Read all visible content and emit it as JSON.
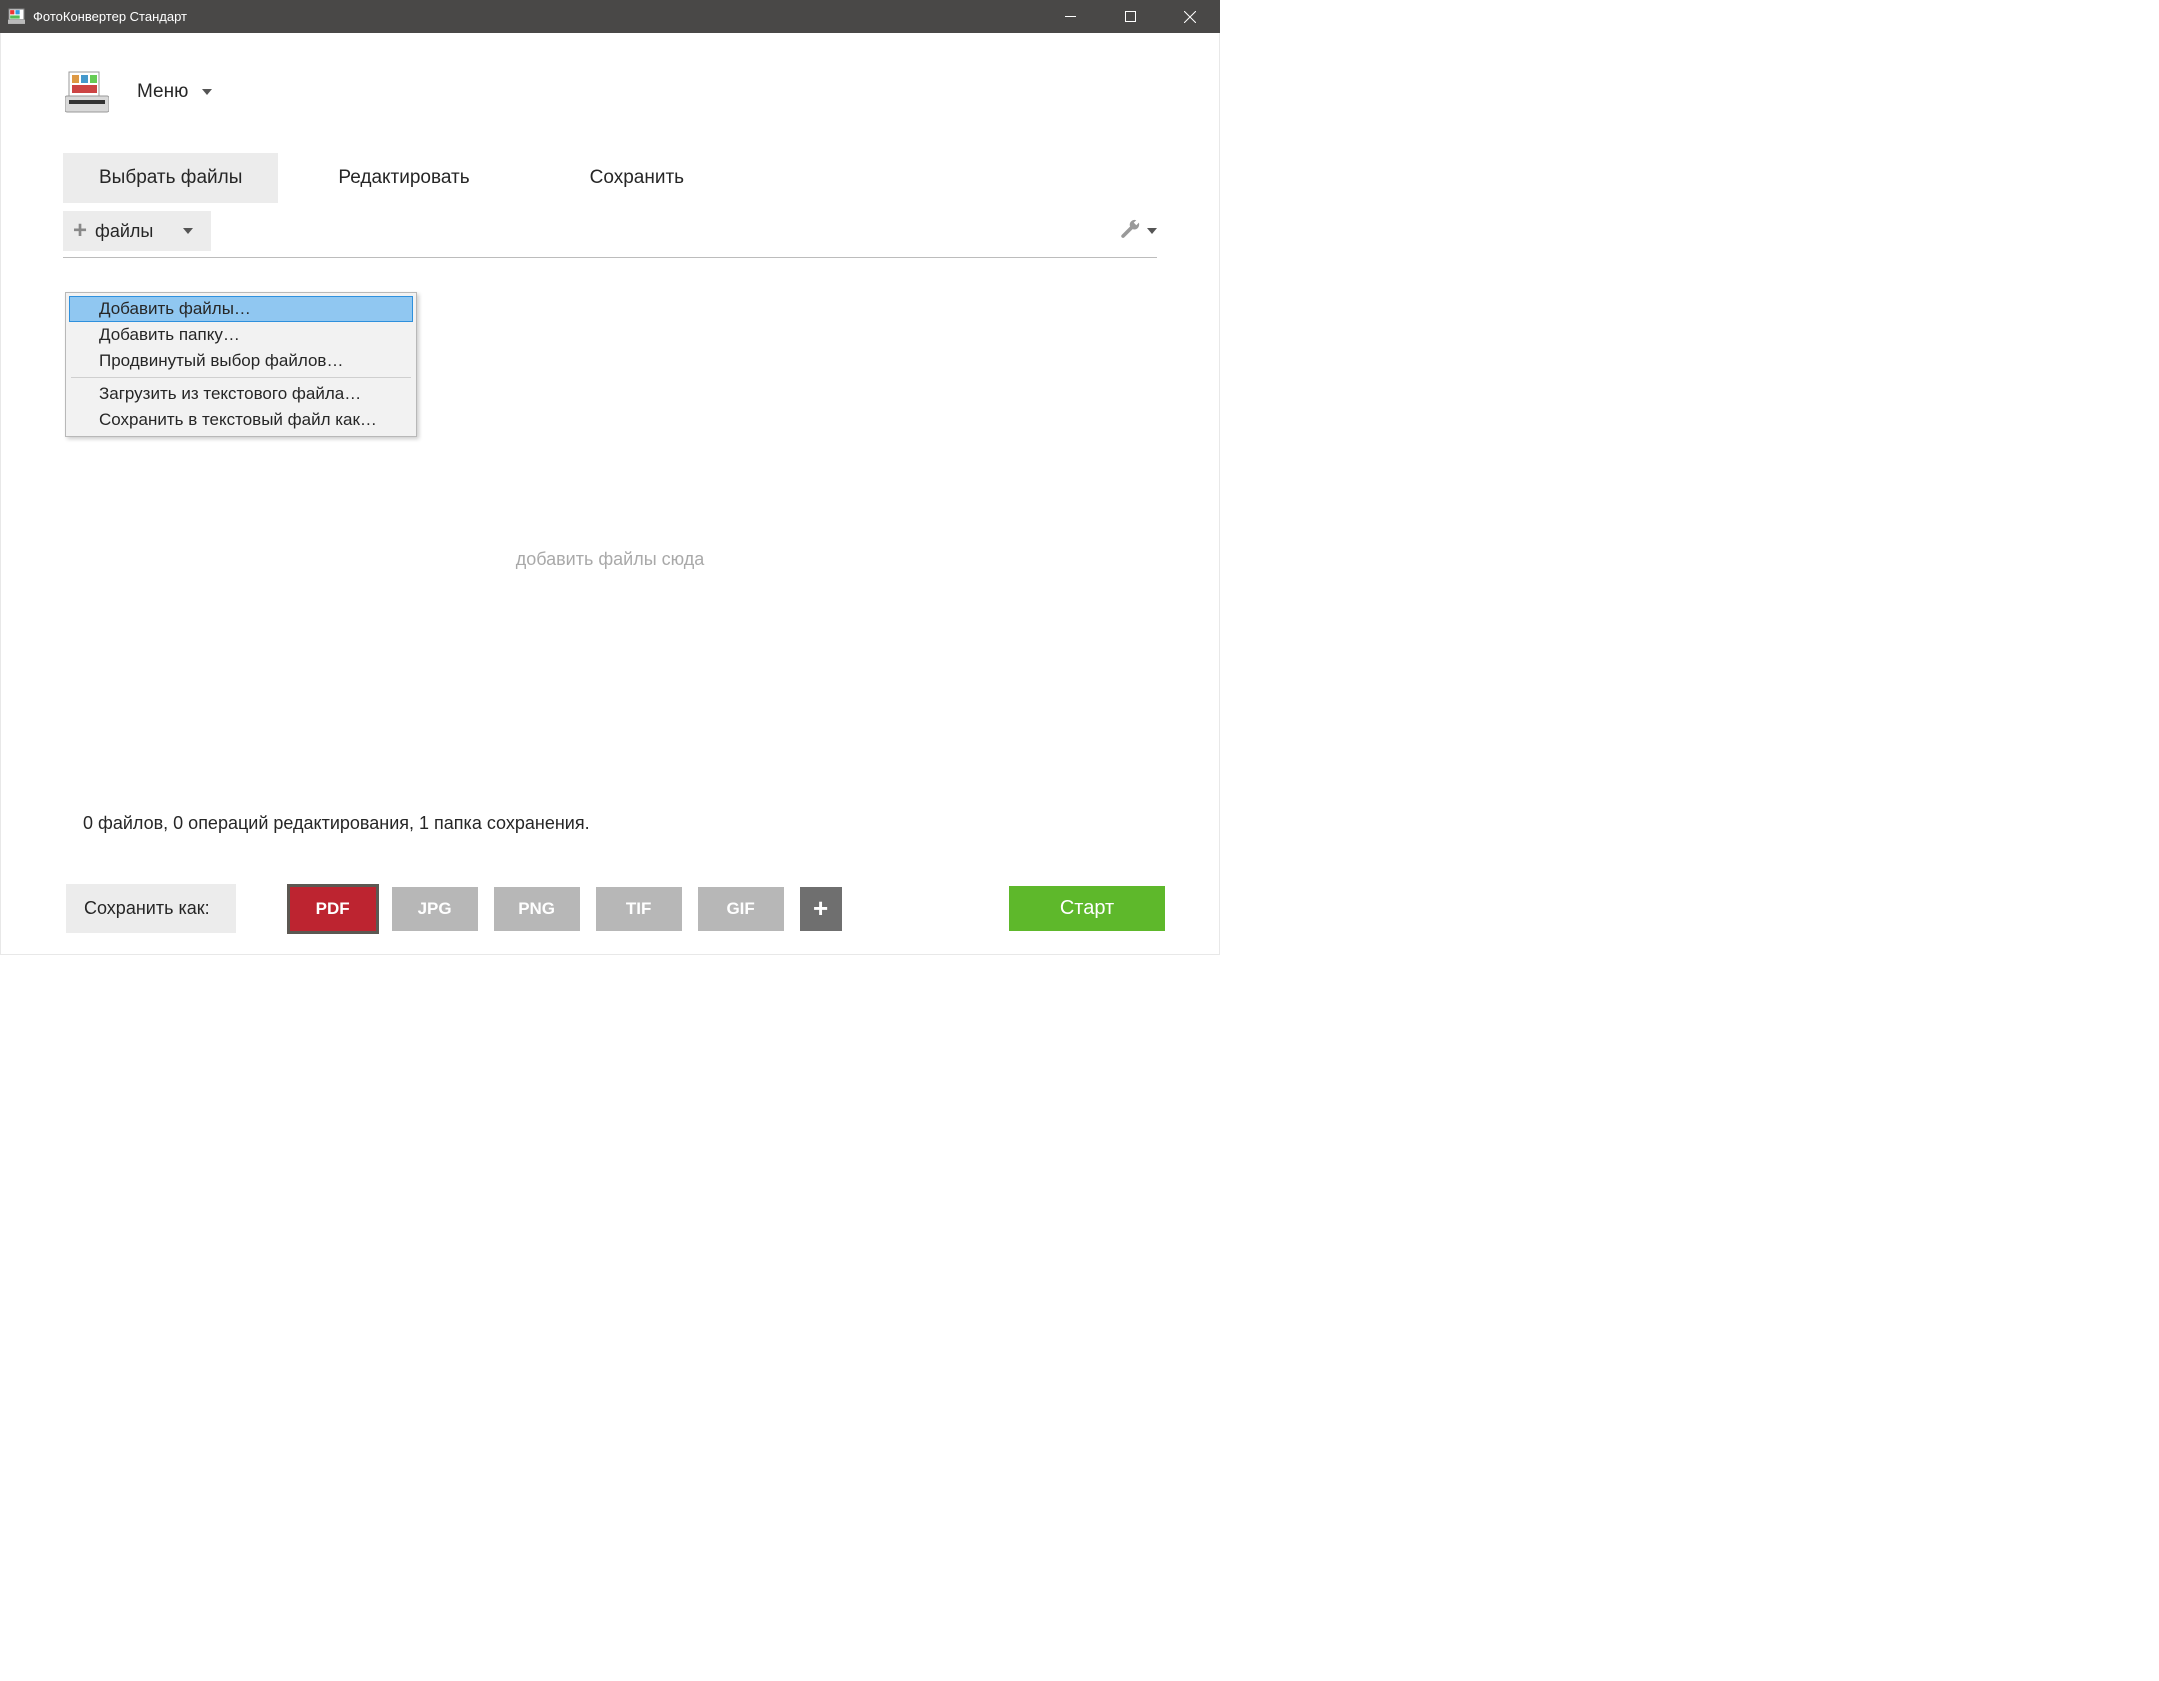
{
  "window": {
    "title": "ФотоКонвертер Стандарт"
  },
  "menu": {
    "label": "Меню"
  },
  "tabs": {
    "select": "Выбрать файлы",
    "edit": "Редактировать",
    "save": "Сохранить"
  },
  "toolbar": {
    "files_label": "файлы"
  },
  "dropdown": {
    "add_files": "Добавить файлы…",
    "add_folder": "Добавить папку…",
    "advanced": "Продвинутый выбор файлов…",
    "load_txt": "Загрузить из текстового файла…",
    "save_txt": "Сохранить в текстовый файл как…"
  },
  "drop_hint": "добавить файлы сюда",
  "status": "0 файлов, 0 операций редактирования, 1 папка сохранения.",
  "save_as": {
    "label": "Сохранить как:",
    "formats": {
      "pdf": "PDF",
      "jpg": "JPG",
      "png": "PNG",
      "tif": "TIF",
      "gif": "GIF"
    }
  },
  "start": "Старт"
}
